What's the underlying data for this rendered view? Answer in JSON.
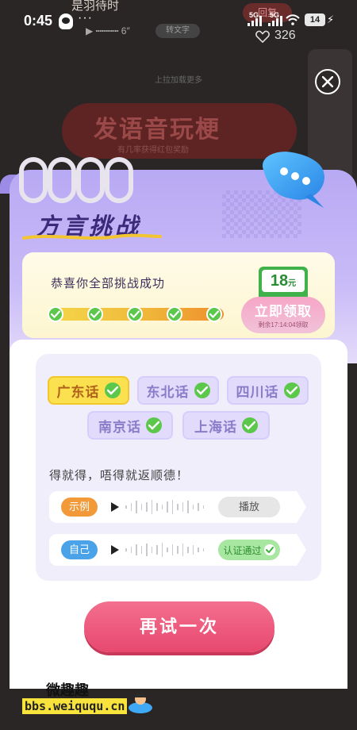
{
  "status_bar": {
    "time": "0:45",
    "dots": "···",
    "battery": "14",
    "net_tag_1": "5G",
    "net_tag_2": "5G"
  },
  "background": {
    "post_title": "是羽待时",
    "reply_label": "回复",
    "likes": "326",
    "transcribe_label": "转文字",
    "load_more": "上拉加载更多",
    "banner_title": "发语音玩梗",
    "banner_subtitle": "有几率获得红包奖励"
  },
  "card": {
    "title": "方言挑战",
    "reward_text": "恭喜你全部挑战成功",
    "progress_steps_done": 5,
    "progress_steps_total": 5,
    "coupon_amount": "18",
    "coupon_unit": "元",
    "claim_label": "立即领取",
    "claim_countdown": "剩余17:14:04领取"
  },
  "dialects": [
    {
      "label": "广东话",
      "active": true
    },
    {
      "label": "东北话",
      "active": false
    },
    {
      "label": "四川话",
      "active": false
    },
    {
      "label": "南京话",
      "active": false
    },
    {
      "label": "上海话",
      "active": false
    }
  ],
  "challenge": {
    "phrase": "得就得，唔得就返顺德！",
    "example_tag": "示例",
    "example_button": "播放",
    "self_tag": "自己",
    "self_status": "认证通过"
  },
  "retry_label": "再试一次",
  "watermark": {
    "name": "微趣趣",
    "site": "bbs.weiququ.cn"
  },
  "colors": {
    "accent_purple": "#b8a9f4",
    "title_purple": "#3b2a7a",
    "active_yellow": "#fbe14f",
    "check_green": "#5cc84b",
    "retry_pink": "#e8486f",
    "example_orange": "#f29a3a",
    "self_blue": "#4aa3e8"
  },
  "icons": [
    "qq-icon",
    "wifi-icon",
    "battery-icon",
    "close-icon",
    "chat-bubble-icon",
    "check-icon",
    "play-icon",
    "heart-icon"
  ]
}
